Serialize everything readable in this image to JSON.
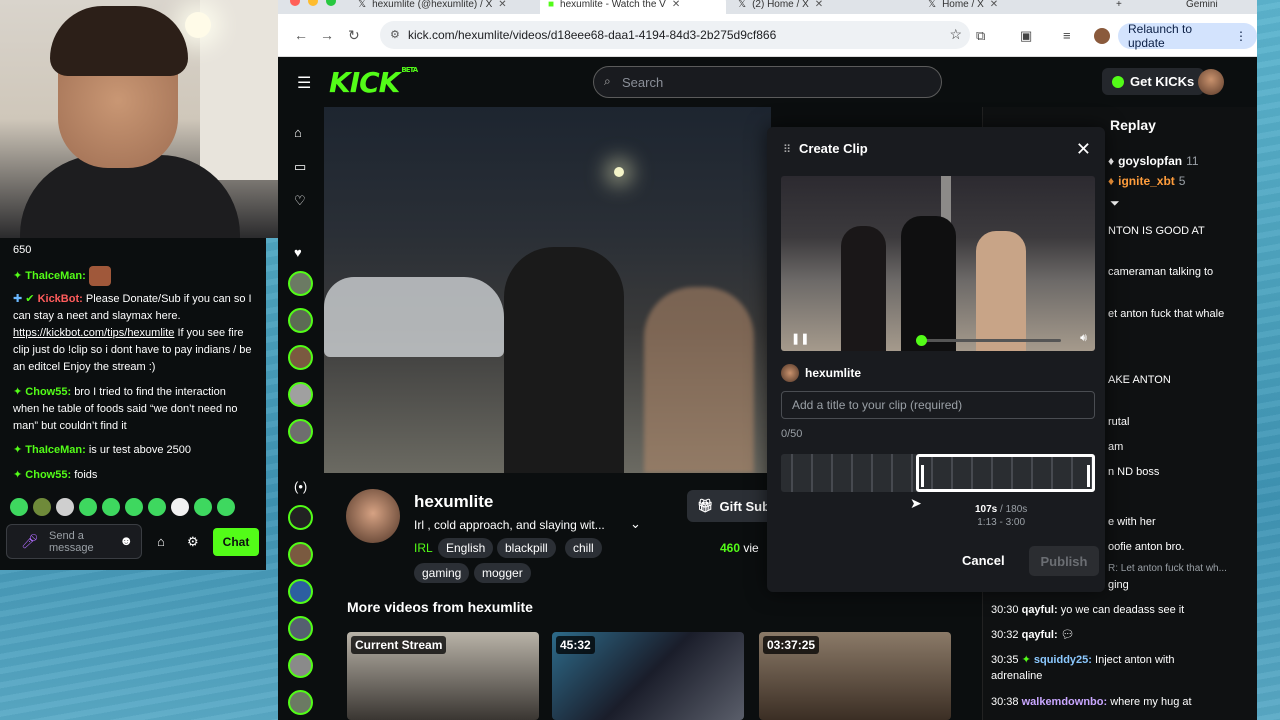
{
  "browser": {
    "tabs": [
      {
        "label": "hexumlite (@hexumlite) / X",
        "active": false
      },
      {
        "label": "hexumlite - Watch the V",
        "active": true
      },
      {
        "label": "(2) Home / X",
        "active": false
      },
      {
        "label": "Home / X",
        "active": false
      }
    ],
    "profile_label": "Gemini",
    "url": "kick.com/hexumlite/videos/d18eee68-daa1-4194-84d3-2b275d9cf866",
    "relaunch_label": "Relaunch to update"
  },
  "kick": {
    "logo": "KICK",
    "logo_badge": "BETA",
    "search_placeholder": "Search",
    "get_kicks_label": "Get KICKs",
    "accent": "#53fc18"
  },
  "channel": {
    "name": "hexumlite",
    "title": "Irl , cold approach, and slaying wit...",
    "category": "IRL",
    "tags": [
      "English",
      "blackpill",
      "chill",
      "gaming",
      "mogger"
    ],
    "gift_sub_label": "Gift Sub",
    "viewers": "460",
    "viewers_suffix": "vie"
  },
  "more_videos": {
    "heading": "More videos from hexumlite",
    "thumbs": [
      {
        "badge": "Current Stream"
      },
      {
        "badge": "45:32"
      },
      {
        "badge": "03:37:25"
      }
    ]
  },
  "clip_modal": {
    "title": "Create Clip",
    "author": "hexumlite",
    "title_placeholder": "Add a title to your clip (required)",
    "char_count": "0/50",
    "selection_duration": "107s",
    "selection_max": "/ 180s",
    "selection_range": "1:13 - 3:00",
    "cancel_label": "Cancel",
    "publish_label": "Publish",
    "playback_progress": 0.0,
    "selection_start_fraction": 0.43,
    "selection_end_fraction": 1.0
  },
  "replay": {
    "title": "Replay",
    "leaders": [
      {
        "user": "goyslopfan",
        "count": "11",
        "color": "#ffffff"
      },
      {
        "user": "ignite_xbt",
        "count": "5",
        "color": "#ff9d3c"
      }
    ],
    "fragments": [
      "NTON IS GOOD AT",
      "cameraman talking to",
      "et anton fuck that whale",
      "AKE ANTON",
      "rutal",
      "am",
      "n ND boss",
      "e with her",
      "oofie anton bro.",
      "R: Let anton fuck that wh...",
      "ging"
    ],
    "messages": [
      {
        "time": "30:30",
        "user": "qayful:",
        "text": "yo we can deadass see it",
        "color": "#ffffff"
      },
      {
        "time": "30:32",
        "user": "qayful:",
        "text": "",
        "color": "#ffffff"
      },
      {
        "time": "30:35",
        "user": "squiddy25:",
        "text": "Inject anton with adrenaline",
        "color": "#8cc9ff"
      },
      {
        "time": "30:38",
        "user": "walkemdownbo:",
        "text": "where my hug at",
        "color": "#c9a7ff"
      }
    ]
  },
  "chat_popup": {
    "top_text": "650",
    "lines": [
      {
        "user": "ThaIceMan:",
        "text": "",
        "color": "#53fc18"
      },
      {
        "user": "KickBot:",
        "text": "Please Donate/Sub if you can so I can stay a neet and slaymax here.",
        "link": "https://kickbot.com/tips/hexumlite",
        "after": "If you see fire clip just do !clip so i dont have to pay indians / be an editcel Enjoy the stream :)",
        "color": "#ff5c5c"
      },
      {
        "user": "Chow55:",
        "text": "bro I tried to find the interaction when he table of foods said “we don’t need no man” but couldn’t find it",
        "color": "#53fc18"
      },
      {
        "user": "ThaIceMan:",
        "text": "is ur test above 2500",
        "color": "#53fc18"
      },
      {
        "user": "Chow55:",
        "text": "foids",
        "color": "#53fc18"
      }
    ],
    "input_placeholder": "Send a message",
    "chat_button": "Chat"
  }
}
